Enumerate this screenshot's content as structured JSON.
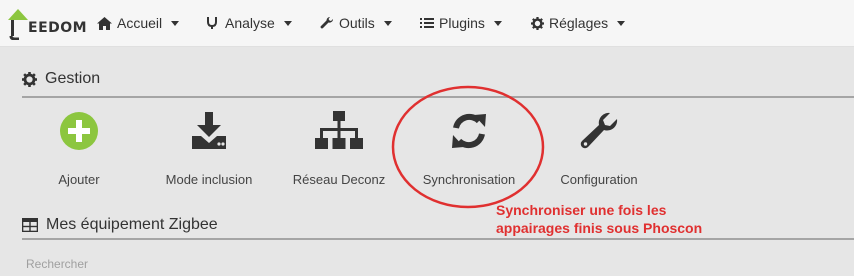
{
  "navbar": {
    "logo_text": "EEDOM",
    "items": [
      {
        "label": "Accueil",
        "icon": "home-icon"
      },
      {
        "label": "Analyse",
        "icon": "stethoscope-icon"
      },
      {
        "label": "Outils",
        "icon": "wrench-icon"
      },
      {
        "label": "Plugins",
        "icon": "list-icon"
      },
      {
        "label": "Réglages",
        "icon": "gear-icon"
      }
    ]
  },
  "gestion": {
    "title": "Gestion",
    "icon": "gear-icon",
    "tiles": [
      {
        "label": "Ajouter",
        "icon": "plus-circle-icon",
        "color": "#8cc63f"
      },
      {
        "label": "Mode inclusion",
        "icon": "download-icon",
        "color": "#333333"
      },
      {
        "label": "Réseau Deconz",
        "icon": "sitemap-icon",
        "color": "#333333"
      },
      {
        "label": "Synchronisation",
        "icon": "sync-icon",
        "color": "#333333"
      },
      {
        "label": "Configuration",
        "icon": "wrench-icon",
        "color": "#333333"
      }
    ]
  },
  "annotation": {
    "line1": "Synchroniser une fois les",
    "line2": "appairages finis sous Phoscon",
    "color": "#e03030"
  },
  "equipements": {
    "title": "Mes équipement Zigbee",
    "icon": "table-icon",
    "search_placeholder": "Rechercher"
  }
}
